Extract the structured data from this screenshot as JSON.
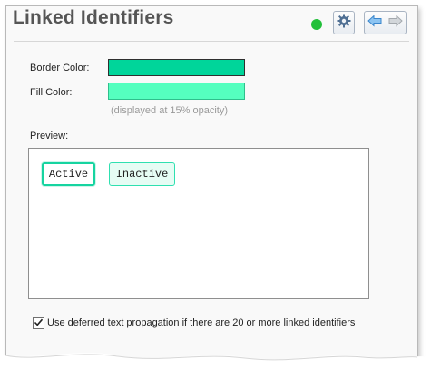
{
  "header": {
    "title": "Linked Identifiers",
    "status_color": "#22c03a",
    "icons": [
      "gear-icon",
      "arrow-left-icon",
      "arrow-right-icon"
    ]
  },
  "colors": {
    "border_label": "Border Color:",
    "border_value": "#00d59a",
    "fill_label": "Fill Color:",
    "fill_value": "#55ffbf",
    "fill_hint": "(displayed at 15% opacity)"
  },
  "preview": {
    "label": "Preview:",
    "active_label": "Active",
    "inactive_label": "Inactive"
  },
  "deferred": {
    "checked": true,
    "label": "Use deferred text propagation if there are 20 or more linked identifiers"
  }
}
